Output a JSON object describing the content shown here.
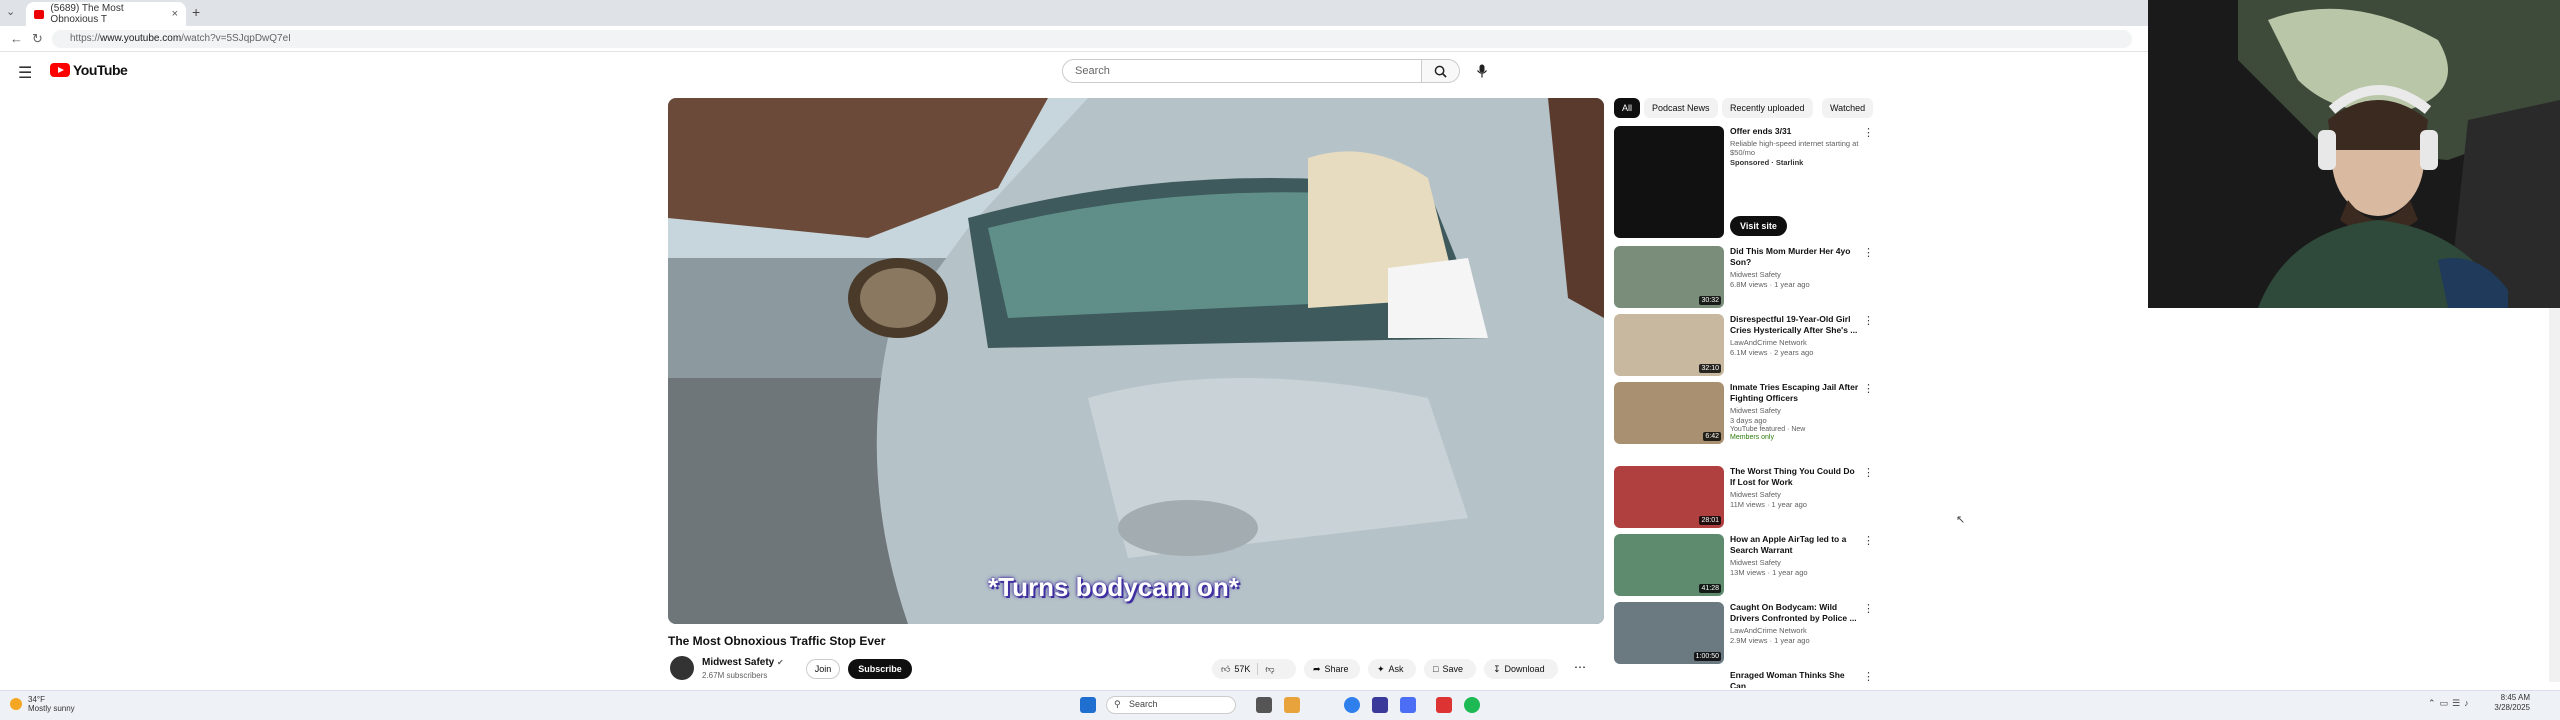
{
  "browser": {
    "tab_title": "(5689) The Most Obnoxious T",
    "url_prefix": "https://",
    "url_domain": "www.youtube.com",
    "url_path": "/watch?v=5SJqpDwQ7eI"
  },
  "header": {
    "logo_text": "YouTube",
    "search_placeholder": "Search"
  },
  "video": {
    "caption": "*Turns bodycam on*",
    "title": "The Most Obnoxious Traffic Stop Ever",
    "channel": "Midwest Safety",
    "subscribers": "2.67M subscribers",
    "join_label": "Join",
    "subscribe_label": "Subscribe",
    "likes": "57K",
    "share_label": "Share",
    "ask_label": "Ask",
    "save_label": "Save",
    "download_label": "Download"
  },
  "chips": [
    "All",
    "Podcast News",
    "Recently uploaded",
    "Watched"
  ],
  "ad": {
    "title": "Offer ends 3/31",
    "description": "Reliable high-speed internet starting at $50/mo",
    "sponsor": "Sponsored · Starlink",
    "cta": "Visit site"
  },
  "recommendations": [
    {
      "title": "Did This Mom Murder Her 4yo Son?",
      "channel": "Midwest Safety",
      "meta": "6.8M views · 1 year ago",
      "duration": "30:32",
      "badge": ""
    },
    {
      "title": "Disrespectful 19-Year-Old Girl Cries Hysterically After She's ...",
      "channel": "LawAndCrime Network",
      "meta": "6.1M views · 2 years ago",
      "duration": "32:10",
      "badge": ""
    },
    {
      "title": "Inmate Tries Escaping Jail After Fighting Officers",
      "channel": "Midwest Safety",
      "meta": "3 days ago",
      "duration": "6:42",
      "badge": "YouTube featured · New",
      "badge2": "Members only"
    },
    {
      "title": "The Worst Thing You Could Do If Lost for Work",
      "channel": "Midwest Safety",
      "meta": "11M views · 1 year ago",
      "duration": "28:01",
      "badge": ""
    },
    {
      "title": "How an Apple AirTag led to a Search Warrant",
      "channel": "Midwest Safety",
      "meta": "13M views · 1 year ago",
      "duration": "41:28",
      "badge": ""
    },
    {
      "title": "Caught On Bodycam: Wild Drivers Confronted by Police ...",
      "channel": "LawAndCrime Network",
      "meta": "2.9M views · 1 year ago",
      "duration": "1:00:50",
      "badge": ""
    },
    {
      "title": "Enraged Woman Thinks She Can",
      "channel": "",
      "meta": "",
      "duration": "",
      "badge": ""
    }
  ],
  "taskbar": {
    "weather_temp": "34°F",
    "weather_desc": "Mostly sunny",
    "search_label": "Search",
    "time": "8:45 AM",
    "date": "3/28/2025"
  },
  "colors": {
    "youtube_red": "#ff0000",
    "caption_outline": "#4030a0"
  }
}
